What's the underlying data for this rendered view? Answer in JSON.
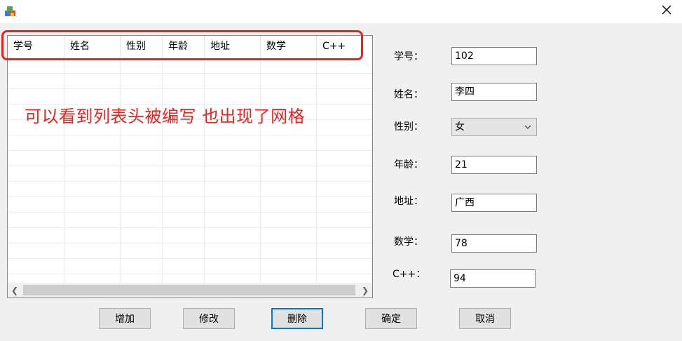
{
  "window": {
    "icon": "app-icon",
    "close_icon": "close-icon"
  },
  "list": {
    "columns": [
      "学号",
      "姓名",
      "性别",
      "年龄",
      "地址",
      "数学",
      "C++"
    ],
    "rows": []
  },
  "annotation": {
    "text": "可以看到列表头被编写  也出现了网格",
    "color": "#e8231d"
  },
  "form": {
    "id_label": "学号：",
    "id_value": "102",
    "name_label": "姓名：",
    "name_value": "李四",
    "gender_label": "性别：",
    "gender_value": "女",
    "age_label": "年龄：",
    "age_value": "21",
    "address_label": "地址：",
    "address_value": "广西",
    "math_label": "数学：",
    "math_value": "78",
    "cpp_label": "C++：",
    "cpp_value": "94"
  },
  "buttons": {
    "add": "增加",
    "modify": "修改",
    "delete": "删除",
    "confirm": "确定",
    "cancel": "取消"
  },
  "colors": {
    "accent": "#0078d7",
    "highlight_red": "#e8231d"
  }
}
